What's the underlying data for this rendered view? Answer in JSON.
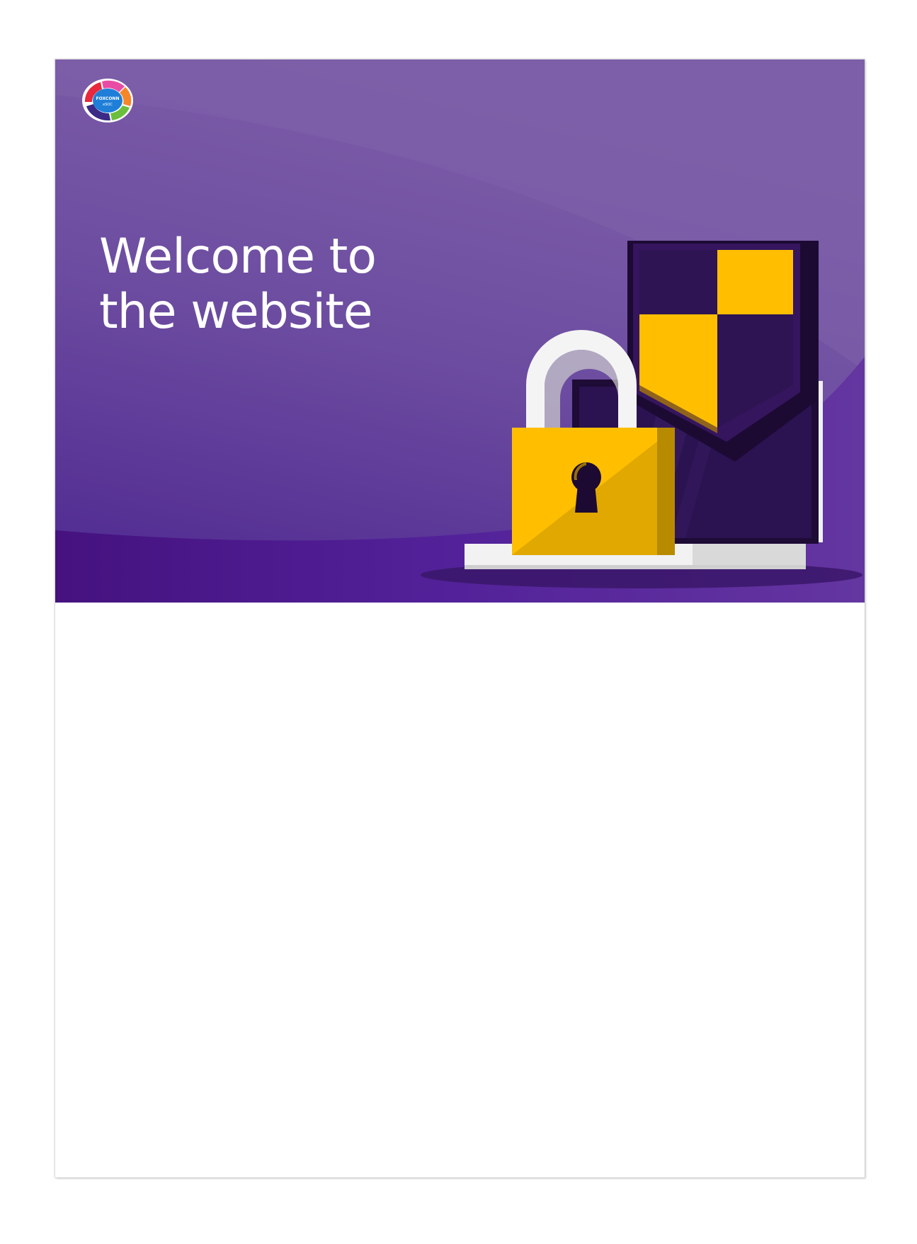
{
  "hero": {
    "headline_line1": "Welcome to",
    "headline_line2": "the website"
  },
  "logo": {
    "brand_text": "FOXCONN",
    "sub_text": "eSOC"
  },
  "illustration": {
    "icons": [
      "padlock-icon",
      "shield-icon",
      "laptop-icon"
    ]
  },
  "colors": {
    "hero_purple_top": "#7d5ea8",
    "hero_purple_bottom": "#4a1a8c",
    "accent_yellow": "#ffbf00",
    "dark_purple": "#2a1248",
    "headline_text": "#ffffff"
  }
}
